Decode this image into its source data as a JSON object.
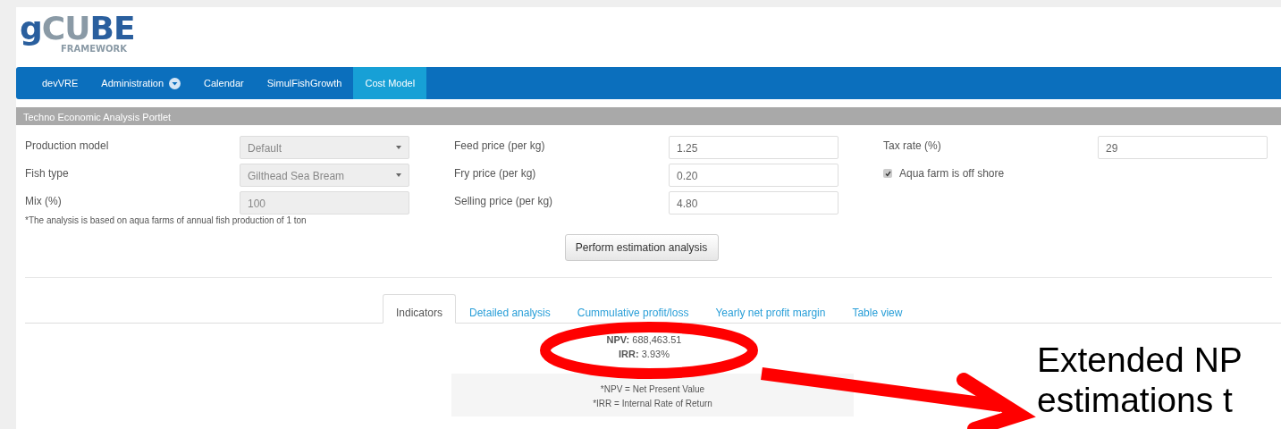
{
  "logo": {
    "parts": [
      {
        "text": "g",
        "color": "#2a5f9e"
      },
      {
        "text": "CU",
        "color": "#8a9aa6"
      },
      {
        "text": "BE",
        "color": "#2a5f9e"
      }
    ],
    "subtitle": "FRAMEWORK"
  },
  "nav": [
    {
      "label": "devVRE",
      "selected": false,
      "dropdown": false
    },
    {
      "label": "Administration",
      "selected": false,
      "dropdown": true
    },
    {
      "label": "Calendar",
      "selected": false,
      "dropdown": false
    },
    {
      "label": "SimulFishGrowth",
      "selected": false,
      "dropdown": false
    },
    {
      "label": "Cost Model",
      "selected": true,
      "dropdown": false
    }
  ],
  "portlet": {
    "title": "Techno Economic Analysis Portlet"
  },
  "form": {
    "columns": [
      [
        {
          "kind": "select",
          "label": "Production model",
          "value": "Default",
          "disabled": true
        },
        {
          "kind": "select",
          "label": "Fish type",
          "value": "Gilthead Sea Bream",
          "disabled": true
        },
        {
          "kind": "input",
          "label": "Mix (%)",
          "value": "100",
          "disabled": true
        }
      ],
      [
        {
          "kind": "input",
          "label": "Feed price (per kg)",
          "value": "1.25",
          "disabled": false
        },
        {
          "kind": "input",
          "label": "Fry price (per kg)",
          "value": "0.20",
          "disabled": false
        },
        {
          "kind": "input",
          "label": "Selling price (per kg)",
          "value": "4.80",
          "disabled": false
        }
      ],
      [
        {
          "kind": "input",
          "label": "Tax rate (%)",
          "value": "29",
          "disabled": false
        },
        {
          "kind": "checkbox",
          "label": "Aqua farm is off shore",
          "checked": true
        }
      ]
    ],
    "note": "*The analysis is based on aqua farms of annual fish production of 1 ton",
    "button": "Perform estimation analysis"
  },
  "tabs": [
    {
      "label": "Indicators",
      "selected": true
    },
    {
      "label": "Detailed analysis",
      "selected": false
    },
    {
      "label": "Cummulative profit/loss",
      "selected": false
    },
    {
      "label": "Yearly net profit margin",
      "selected": false
    },
    {
      "label": "Table view",
      "selected": false
    }
  ],
  "results": {
    "lines": [
      "**NPV:** 688,463.51",
      "**IRR:** 3.93%"
    ],
    "legend": [
      "*NPV = Net Present Value",
      "*IRR = Internal Rate of Return"
    ]
  },
  "annotation": {
    "lines": [
      "Extended NP",
      "estimations t"
    ]
  }
}
